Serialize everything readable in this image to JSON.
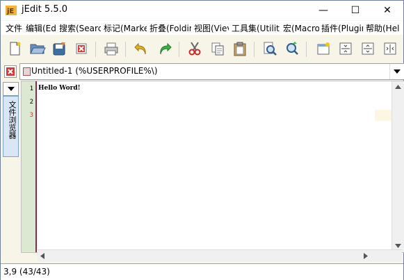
{
  "window": {
    "title": "jEdit  5.5.0",
    "controls": {
      "minimize": "—",
      "maximize": "☐",
      "close": "✕"
    }
  },
  "menu": {
    "items": [
      "文件",
      "编辑(Ed",
      "搜索(Searc",
      "标记(Marke",
      "折叠(Foldir",
      "视图(Viev",
      "工具集(Utiliti",
      "宏(Macro",
      "插件(Plugir",
      "帮助(Hel"
    ]
  },
  "toolbar": {
    "buttons": [
      "new-file-icon",
      "open-file-icon",
      "save-file-icon",
      "close-file-icon",
      "print-icon",
      "undo-icon",
      "redo-icon",
      "cut-icon",
      "copy-icon",
      "paste-icon",
      "find-icon",
      "find-next-icon",
      "new-view-icon",
      "split-horizontal-icon",
      "split-vertical-icon",
      "unsplit-icon"
    ]
  },
  "buffer": {
    "selector_label": "Untitled-1 (%USERPROFILE%\\)"
  },
  "dock": {
    "tab_label": "文件浏览器"
  },
  "editor": {
    "line_numbers": [
      "1",
      "2",
      "3"
    ],
    "lines": [
      "Hello Word!",
      "",
      ""
    ]
  },
  "statusbar": {
    "text": "3,9 (43/43)"
  },
  "colors": {
    "gutter": "#dce8d2",
    "gutter_border": "#8a2a4d",
    "chrome": "#f7f5e8"
  }
}
